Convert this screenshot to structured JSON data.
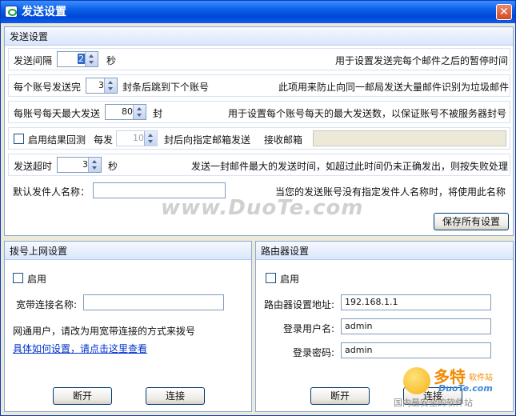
{
  "window": {
    "title": "发送设置",
    "close_glyph": "✕"
  },
  "send_settings": {
    "header": "发送设置",
    "interval": {
      "label": "发送间隔",
      "value": "2",
      "unit": "秒",
      "desc": "用于设置发送完每个邮件之后的暂停时间"
    },
    "per_account": {
      "label_pre": "每个账号发送完",
      "value": "3",
      "label_post": "封条后跳到下个账号",
      "desc": "此项用来防止向同一邮局发送大量邮件识别为垃圾邮件"
    },
    "daily_max": {
      "label": "每账号每天最大发送",
      "value": "80",
      "unit": "封",
      "desc": "用于设置每个账号每天的最大发送数，以保证账号不被服务器封号"
    },
    "feedback": {
      "checkbox_label": "启用结果回测",
      "every_label": "每发",
      "value": "10",
      "after_label": "封后向指定邮箱发送",
      "receive_label": "接收邮箱",
      "receive_value": ""
    },
    "timeout": {
      "label": "发送超时",
      "value": "3",
      "unit": "秒",
      "desc": "发送一封邮件最大的发送时间，如超过此时间仍未正确发出，则按失败处理"
    },
    "sender_name": {
      "label": "默认发件人名称：",
      "value": "",
      "desc": "当您的发送账号没有指定发件人名称时，将使用此名称"
    },
    "save_button": "保存所有设置"
  },
  "dialup": {
    "header": "拨号上网设置",
    "enable_label": "启用",
    "conn_label": "宽带连接名称:",
    "conn_value": "",
    "note": "网通用户，请改为用宽带连接的方式来拨号",
    "help_link": "具体如何设置，请点击这里查看",
    "disconnect": "断开",
    "connect": "连接"
  },
  "router": {
    "header": "路由器设置",
    "enable_label": "启用",
    "addr_label": "路由器设置地址:",
    "addr_value": "192.168.1.1",
    "user_label": "登录用户名:",
    "user_value": "admin",
    "pass_label": "登录密码:",
    "pass_value": "admin",
    "disconnect": "断开",
    "connect": "连接"
  },
  "watermark": {
    "center": "www.DuoTe.com",
    "brand": "多特",
    "brand_sub": "软件站",
    "site": "DuoTe.com",
    "slogan": "国内最安全的软件站"
  }
}
